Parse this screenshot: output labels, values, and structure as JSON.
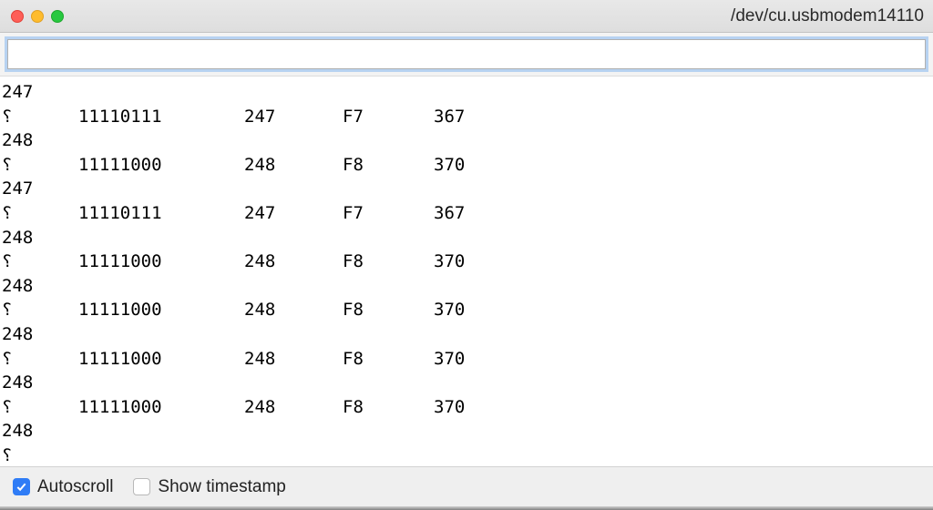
{
  "window": {
    "title": "/dev/cu.usbmodem14110"
  },
  "input": {
    "value": "",
    "placeholder": ""
  },
  "log": {
    "unknown_char": "⸮",
    "lines": [
      {
        "type": "index",
        "index": "247"
      },
      {
        "type": "data",
        "char": "⸮",
        "bin": "11110111",
        "dec": "247",
        "hex": "F7",
        "oct": "367"
      },
      {
        "type": "index",
        "index": "248"
      },
      {
        "type": "data",
        "char": "⸮",
        "bin": "11111000",
        "dec": "248",
        "hex": "F8",
        "oct": "370"
      },
      {
        "type": "index",
        "index": "247"
      },
      {
        "type": "data",
        "char": "⸮",
        "bin": "11110111",
        "dec": "247",
        "hex": "F7",
        "oct": "367"
      },
      {
        "type": "index",
        "index": "248"
      },
      {
        "type": "data",
        "char": "⸮",
        "bin": "11111000",
        "dec": "248",
        "hex": "F8",
        "oct": "370"
      },
      {
        "type": "index",
        "index": "248"
      },
      {
        "type": "data",
        "char": "⸮",
        "bin": "11111000",
        "dec": "248",
        "hex": "F8",
        "oct": "370"
      },
      {
        "type": "index",
        "index": "248"
      },
      {
        "type": "data",
        "char": "⸮",
        "bin": "11111000",
        "dec": "248",
        "hex": "F8",
        "oct": "370"
      },
      {
        "type": "index",
        "index": "248"
      },
      {
        "type": "data",
        "char": "⸮",
        "bin": "11111000",
        "dec": "248",
        "hex": "F8",
        "oct": "370"
      },
      {
        "type": "index",
        "index": "248"
      },
      {
        "type": "partial",
        "char": "⸮"
      }
    ]
  },
  "footer": {
    "autoscroll": {
      "label": "Autoscroll",
      "checked": true
    },
    "timestamp": {
      "label": "Show timestamp",
      "checked": false
    }
  }
}
